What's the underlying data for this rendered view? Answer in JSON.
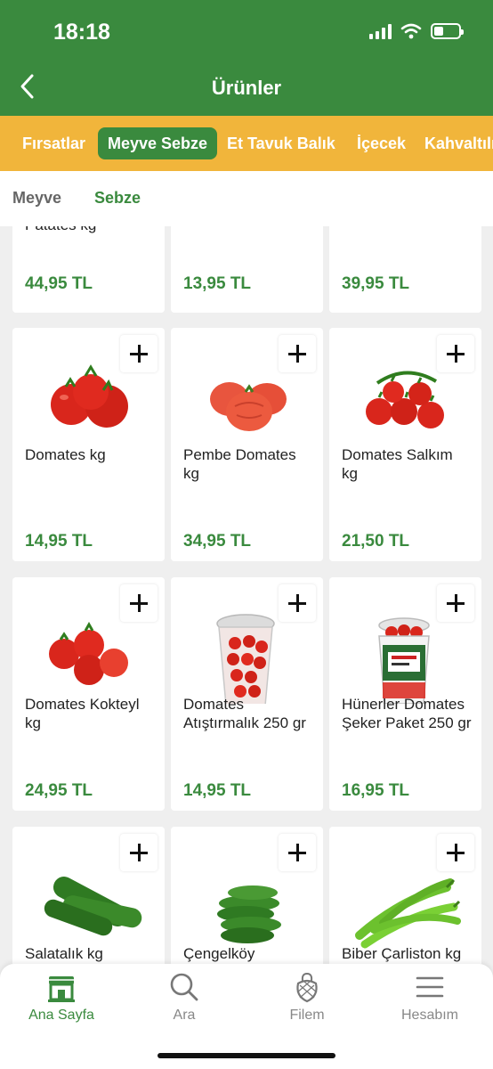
{
  "status": {
    "time": "18:18"
  },
  "header": {
    "title": "Ürünler"
  },
  "categories": [
    {
      "label": "Fırsatlar",
      "active": false
    },
    {
      "label": "Meyve Sebze",
      "active": true
    },
    {
      "label": "Et Tavuk Balık",
      "active": false
    },
    {
      "label": "İçecek",
      "active": false
    },
    {
      "label": "Kahvaltılık",
      "active": false
    }
  ],
  "subcategories": [
    {
      "label": "Meyve",
      "active": false
    },
    {
      "label": "Sebze",
      "active": true
    }
  ],
  "partial_row": [
    {
      "name": "Patates kg",
      "price": "44,95 TL"
    },
    {
      "name": "",
      "price": "13,95 TL"
    },
    {
      "name": "",
      "price": "39,95 TL"
    }
  ],
  "products": [
    {
      "name": "Domates kg",
      "price": "14,95 TL",
      "icon": "tomato-icon"
    },
    {
      "name": "Pembe Domates kg",
      "price": "34,95 TL",
      "icon": "pink-tomato-icon"
    },
    {
      "name": "Domates Salkım kg",
      "price": "21,50 TL",
      "icon": "tomato-cluster-icon"
    },
    {
      "name": "Domates Kokteyl kg",
      "price": "24,95 TL",
      "icon": "cocktail-tomato-icon"
    },
    {
      "name": "Domates Atıştırmalık 250 gr",
      "price": "14,95 TL",
      "icon": "snack-tomato-cup-icon"
    },
    {
      "name": "Hünerler Domates Şeker Paket 250 gr",
      "price": "16,95 TL",
      "icon": "cherry-tomato-pack-icon"
    },
    {
      "name": "Salatalık kg",
      "price": "",
      "icon": "cucumber-icon"
    },
    {
      "name": "Çengelköy",
      "price": "",
      "icon": "small-cucumber-icon"
    },
    {
      "name": "Biber Çarliston kg",
      "price": "",
      "icon": "green-pepper-icon"
    }
  ],
  "tabbar": [
    {
      "label": "Ana Sayfa",
      "icon": "store-icon",
      "active": true
    },
    {
      "label": "Ara",
      "icon": "search-icon",
      "active": false
    },
    {
      "label": "Filem",
      "icon": "net-bag-icon",
      "active": false
    },
    {
      "label": "Hesabım",
      "icon": "menu-icon",
      "active": false
    }
  ],
  "colors": {
    "primary": "#3a8a3e",
    "category_bar": "#f1b53b",
    "price": "#3a8a3e"
  }
}
